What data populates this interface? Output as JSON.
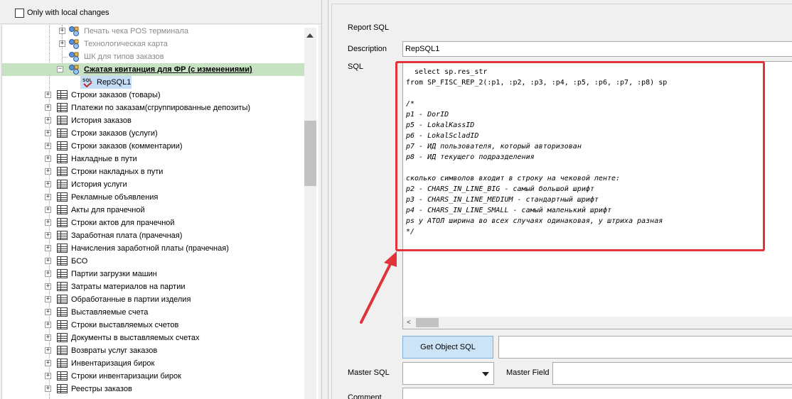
{
  "filter": {
    "local_changes_label": "Only with local changes"
  },
  "tree": {
    "children_top": [
      {
        "label": "Печать чека POS терминала",
        "muted": true
      },
      {
        "label": "Технологическая карта",
        "muted": true
      },
      {
        "label": "ШК для типов заказов",
        "muted": true
      }
    ],
    "selected_node": "Сжатая квитанция для ФР (с изменениями)",
    "selected_child": "RepSQL1",
    "tables": [
      "Строки заказов (товары)",
      "Платежи по заказам(сгруппированные депозиты)",
      "История заказов",
      "Строки заказов (услуги)",
      "Строки заказов (комментарии)",
      "Накладные в пути",
      "Строки накладных в пути",
      "История услуги",
      "Рекламные объявления",
      "Акты для прачечной",
      "Строки актов для прачечной",
      "Заработная плата (прачечная)",
      "Начисления заработной платы (прачечная)",
      "БСО",
      "Партии загрузки машин",
      "Затраты материалов на партии",
      "Обработанные в партии изделия",
      "Выставляемые счета",
      "Строки выставляемых счетов",
      "Документы в выставляемых счетах",
      "Возвраты услуг заказов",
      "Инвентаризация бирок",
      "Строки инвентаризации бирок",
      "Реестры заказов"
    ]
  },
  "form": {
    "report_sql_label": "Report SQL",
    "description_label": "Description",
    "description_value": "RepSQL1",
    "sql_label": "SQL",
    "sql_lines": [
      {
        "text": "  select sp.res_str",
        "comment": false
      },
      {
        "text": "from SP_FISC_REP_2(:p1, :p2, :p3, :p4, :p5, :p6, :p7, :p8) sp",
        "comment": false
      },
      {
        "text": "",
        "comment": false
      },
      {
        "text": "/*",
        "comment": true
      },
      {
        "text": "p1 - DorID",
        "comment": true
      },
      {
        "text": "p5 - LokalKassID",
        "comment": true
      },
      {
        "text": "p6 - LokalScladID",
        "comment": true
      },
      {
        "text": "p7 - ИД пользователя, который авторизован",
        "comment": true
      },
      {
        "text": "p8 - ИД текущего подразделения",
        "comment": true
      },
      {
        "text": "",
        "comment": true
      },
      {
        "text": "сколько символов входит в строку на чековой ленте:",
        "comment": true
      },
      {
        "text": "p2 - CHARS_IN_LINE_BIG - самый большой шрифт",
        "comment": true
      },
      {
        "text": "p3 - CHARS_IN_LINE_MEDIUM - стандартный шрифт",
        "comment": true
      },
      {
        "text": "p4 - CHARS_IN_LINE_SMALL - самый маленький шрифт",
        "comment": true
      },
      {
        "text": "ps у АТОЛ ширина во всех случаях одинаковая, у штриха разная",
        "comment": true
      },
      {
        "text": "*/",
        "comment": true
      }
    ],
    "get_object_sql_button": "Get Object SQL",
    "master_sql_label": "Master SQL",
    "master_field_label": "Master Field",
    "comment_label": "Comment"
  },
  "colors": {
    "annotation_red": "#e0333a",
    "selected_row": "#c6e2c2",
    "highlight_row": "#c4dcf6"
  }
}
